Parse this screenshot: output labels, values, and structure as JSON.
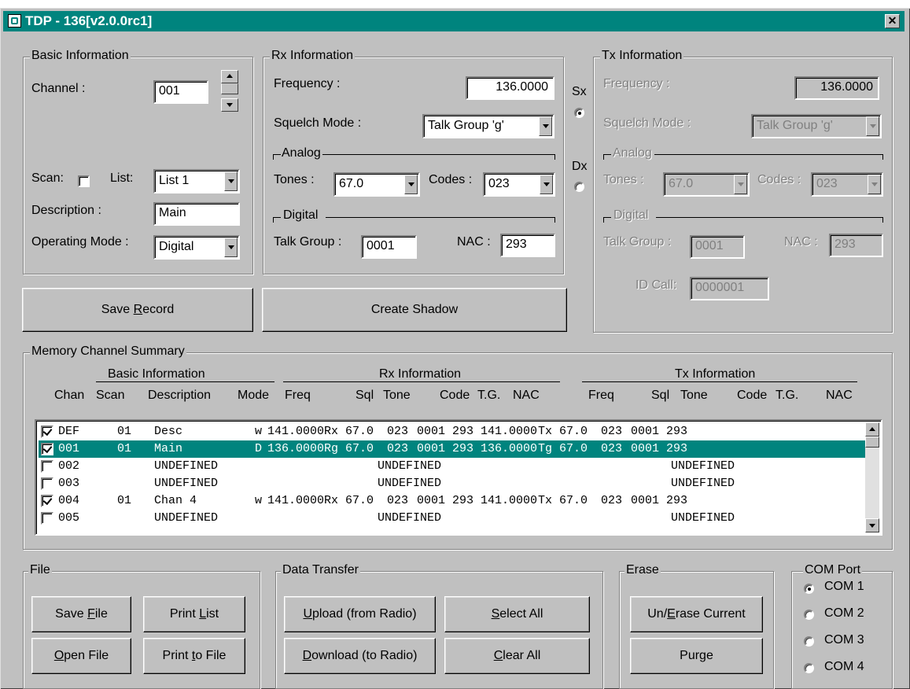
{
  "window": {
    "title": "TDP - 136[v2.0.0rc1]",
    "close_label": "✕"
  },
  "basic": {
    "legend": "Basic Information",
    "channel_label": "Channel :",
    "channel_value": "001",
    "scan_label": "Scan:",
    "scan_checked": false,
    "list_label": "List:",
    "list_value": "List 1",
    "description_label": "Description :",
    "description_value": "Main",
    "opmode_label": "Operating Mode :",
    "opmode_value": "Digital"
  },
  "rx": {
    "legend": "Rx Information",
    "frequency_label": "Frequency :",
    "frequency_value": "136.0000",
    "squelch_label": "Squelch Mode :",
    "squelch_value": "Talk Group  'g'",
    "analog_label": "Analog",
    "tones_label": "Tones :",
    "tones_value": "67.0",
    "codes_label": "Codes :",
    "codes_value": "023",
    "digital_label": "Digital",
    "talkgroup_label": "Talk Group :",
    "talkgroup_value": "0001",
    "nac_label": "NAC :",
    "nac_value": "293"
  },
  "mode": {
    "sx_label": "Sx",
    "dx_label": "Dx",
    "selected": "Sx"
  },
  "tx": {
    "legend": "Tx Information",
    "frequency_label": "Frequency :",
    "frequency_value": "136.0000",
    "squelch_label": "Squelch Mode :",
    "squelch_value": "Talk Group  'g'",
    "analog_label": "Analog",
    "tones_label": "Tones :",
    "tones_value": "67.0",
    "codes_label": "Codes :",
    "codes_value": "023",
    "digital_label": "Digital",
    "talkgroup_label": "Talk Group :",
    "talkgroup_value": "0001",
    "nac_label": "NAC :",
    "nac_value": "293",
    "idcall_label": "ID Call:",
    "idcall_value": "0000001"
  },
  "buttons": {
    "save_record": {
      "pre": "Save ",
      "u": "R",
      "post": "ecord"
    },
    "create_shadow": "Create Shadow"
  },
  "summary": {
    "legend": "Memory Channel Summary",
    "group_basic": "Basic Information",
    "group_rx": "Rx Information",
    "group_tx": "Tx Information",
    "columns": [
      "Chan",
      "Scan",
      "Description",
      "Mode",
      "Freq",
      "Sql",
      "Tone",
      "Code",
      "T.G.",
      "NAC",
      "Freq",
      "Sql",
      "Tone",
      "Code",
      "T.G.",
      "NAC"
    ],
    "rows": [
      {
        "checked": true,
        "chan": "DEF",
        "scan": "01",
        "desc": "Desc",
        "mode": "w",
        "rx_freq": "141.0000",
        "rx_sql": "Rx",
        "rx_tone": "67.0",
        "rx_code": "023",
        "rx_tg": "0001",
        "rx_nac": "293",
        "rx_undef": "",
        "tx_freq": "141.0000",
        "tx_sql": "Tx",
        "tx_tone": "67.0",
        "tx_code": "023",
        "tx_tg": "0001",
        "tx_nac": "293",
        "tx_undef": ""
      },
      {
        "checked": true,
        "chan": "001",
        "scan": "01",
        "desc": "Main",
        "mode": "D",
        "rx_freq": "136.0000",
        "rx_sql": "Rg",
        "rx_tone": "67.0",
        "rx_code": "023",
        "rx_tg": "0001",
        "rx_nac": "293",
        "rx_undef": "",
        "tx_freq": "136.0000",
        "tx_sql": "Tg",
        "tx_tone": "67.0",
        "tx_code": "023",
        "tx_tg": "0001",
        "tx_nac": "293",
        "tx_undef": "",
        "selected": true
      },
      {
        "checked": false,
        "chan": "002",
        "scan": "",
        "desc": "UNDEFINED",
        "mode": "",
        "rx_freq": "",
        "rx_sql": "",
        "rx_tone": "",
        "rx_code": "",
        "rx_tg": "",
        "rx_nac": "",
        "rx_undef": "UNDEFINED",
        "tx_freq": "",
        "tx_sql": "",
        "tx_tone": "",
        "tx_code": "",
        "tx_tg": "",
        "tx_nac": "",
        "tx_undef": "UNDEFINED"
      },
      {
        "checked": false,
        "chan": "003",
        "scan": "",
        "desc": "UNDEFINED",
        "mode": "",
        "rx_freq": "",
        "rx_sql": "",
        "rx_tone": "",
        "rx_code": "",
        "rx_tg": "",
        "rx_nac": "",
        "rx_undef": "UNDEFINED",
        "tx_freq": "",
        "tx_sql": "",
        "tx_tone": "",
        "tx_code": "",
        "tx_tg": "",
        "tx_nac": "",
        "tx_undef": "UNDEFINED"
      },
      {
        "checked": true,
        "chan": "004",
        "scan": "01",
        "desc": "Chan 4",
        "mode": "w",
        "rx_freq": "141.0000",
        "rx_sql": "Rx",
        "rx_tone": "67.0",
        "rx_code": "023",
        "rx_tg": "0001",
        "rx_nac": "293",
        "rx_undef": "",
        "tx_freq": "141.0000",
        "tx_sql": "Tx",
        "tx_tone": "67.0",
        "tx_code": "023",
        "tx_tg": "0001",
        "tx_nac": "293",
        "tx_undef": ""
      },
      {
        "checked": false,
        "chan": "005",
        "scan": "",
        "desc": "UNDEFINED",
        "mode": "",
        "rx_freq": "",
        "rx_sql": "",
        "rx_tone": "",
        "rx_code": "",
        "rx_tg": "",
        "rx_nac": "",
        "rx_undef": "UNDEFINED",
        "tx_freq": "",
        "tx_sql": "",
        "tx_tone": "",
        "tx_code": "",
        "tx_tg": "",
        "tx_nac": "",
        "tx_undef": "UNDEFINED"
      }
    ]
  },
  "file": {
    "legend": "File",
    "save_file": {
      "pre": "Save ",
      "u": "F",
      "post": "ile"
    },
    "print_list": {
      "pre": "Print ",
      "u": "L",
      "post": "ist"
    },
    "open_file": {
      "pre": "",
      "u": "O",
      "post": "pen File"
    },
    "print_to_file": {
      "pre": "Print ",
      "u": "t",
      "post": "o File"
    }
  },
  "transfer": {
    "legend": "Data Transfer",
    "upload": {
      "pre": "",
      "u": "U",
      "post": "pload (from Radio)"
    },
    "select_all": {
      "pre": "",
      "u": "S",
      "post": "elect All"
    },
    "download": {
      "pre": "",
      "u": "D",
      "post": "ownload (to Radio)"
    },
    "clear_all": {
      "pre": "",
      "u": "C",
      "post": "lear All"
    }
  },
  "erase": {
    "legend": "Erase",
    "unerase": {
      "pre": "Un/",
      "u": "E",
      "post": "rase Current"
    },
    "purge": "Purge"
  },
  "com": {
    "legend": "COM Port",
    "options": [
      "COM 1",
      "COM 2",
      "COM 3",
      "COM 4"
    ],
    "selected": "COM 1"
  },
  "colors": {
    "title_bar": "#00847e",
    "face": "#c0c0c0",
    "selection": "#00847e"
  }
}
